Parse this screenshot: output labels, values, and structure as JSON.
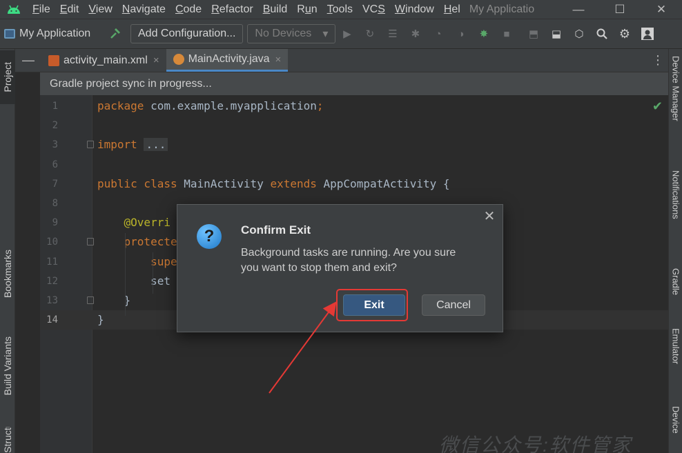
{
  "menubar": {
    "items": [
      {
        "label": "File",
        "key": "F",
        "rest": "ile"
      },
      {
        "label": "Edit",
        "key": "E",
        "rest": "dit"
      },
      {
        "label": "View",
        "key": "V",
        "rest": "iew"
      },
      {
        "label": "Navigate",
        "key": "N",
        "rest": "avigate"
      },
      {
        "label": "Code",
        "key": "C",
        "rest": "ode"
      },
      {
        "label": "Refactor",
        "key": "R",
        "rest": "efactor"
      },
      {
        "label": "Build",
        "key": "B",
        "rest": "uild"
      },
      {
        "label": "Run",
        "key": "",
        "pre": "R",
        "ukey": "u",
        "rest": "n"
      },
      {
        "label": "Tools",
        "key": "T",
        "rest": "ools"
      },
      {
        "label": "VCS",
        "key": "",
        "pre": "VC",
        "ukey": "S",
        "rest": ""
      },
      {
        "label": "Window",
        "key": "W",
        "rest": "indow"
      },
      {
        "label": "Hel",
        "key": "H",
        "rest": "el"
      }
    ],
    "window_title": "My Applicatio",
    "minimize": "—",
    "maximize": "☐",
    "close": "✕"
  },
  "toolbar": {
    "project_name": "My Application",
    "add_configuration": "Add Configuration...",
    "devices": "No Devices",
    "devices_arrow": "▾"
  },
  "left_strip": {
    "project": "Project",
    "bookmarks": "Bookmarks",
    "build_variants": "Build Variants",
    "structure": "Structure"
  },
  "right_strip": {
    "device_manager": "Device Manager",
    "notifications": "Notifications",
    "gradle": "Gradle",
    "emulator": "Emulator",
    "device_explorer": "Device"
  },
  "tabs": [
    {
      "label": "activity_main.xml",
      "close": "×"
    },
    {
      "label": "MainActivity.java",
      "close": "×"
    }
  ],
  "sync_banner": "Gradle project sync in progress...",
  "editor": {
    "lines": [
      {
        "n": "1",
        "parts": [
          {
            "t": "package",
            "c": "kw"
          },
          {
            "t": " com.example.myapplication",
            "c": ""
          },
          {
            "t": ";",
            "c": "kw"
          }
        ]
      },
      {
        "n": "2",
        "parts": []
      },
      {
        "n": "3",
        "parts": [
          {
            "t": "import",
            "c": "kw"
          },
          {
            "t": " ",
            "c": ""
          },
          {
            "t": "...",
            "c": "fold-text"
          }
        ]
      },
      {
        "n": "6",
        "parts": []
      },
      {
        "n": "7",
        "parts": [
          {
            "t": "public class",
            "c": "kw"
          },
          {
            "t": " MainActivity ",
            "c": ""
          },
          {
            "t": "extends",
            "c": "kw"
          },
          {
            "t": " AppCompatActivity {",
            "c": ""
          }
        ]
      },
      {
        "n": "8",
        "parts": []
      },
      {
        "n": "9",
        "parts": [
          {
            "t": "    @Overri",
            "c": "ann"
          }
        ]
      },
      {
        "n": "10",
        "parts": [
          {
            "t": "    protecte",
            "c": "kw"
          }
        ]
      },
      {
        "n": "11",
        "parts": [
          {
            "t": "        supe",
            "c": "kw"
          }
        ]
      },
      {
        "n": "12",
        "parts": [
          {
            "t": "        set",
            "c": ""
          }
        ]
      },
      {
        "n": "13",
        "parts": [
          {
            "t": "    }",
            "c": ""
          }
        ]
      },
      {
        "n": "14",
        "parts": [
          {
            "t": "}",
            "c": ""
          }
        ]
      }
    ],
    "current_line": "14",
    "watermark": "微信公众号:软件管家"
  },
  "dialog": {
    "title": "Confirm Exit",
    "message": "Background tasks are running. Are you sure you want to stop them and exit?",
    "icon": "?",
    "exit_label": "Exit",
    "cancel_label": "Cancel",
    "close": "✕"
  },
  "colors": {
    "accent_blue": "#365880",
    "annotation_red": "#e53935",
    "keyword": "#cc7832",
    "success_green": "#59a869"
  }
}
